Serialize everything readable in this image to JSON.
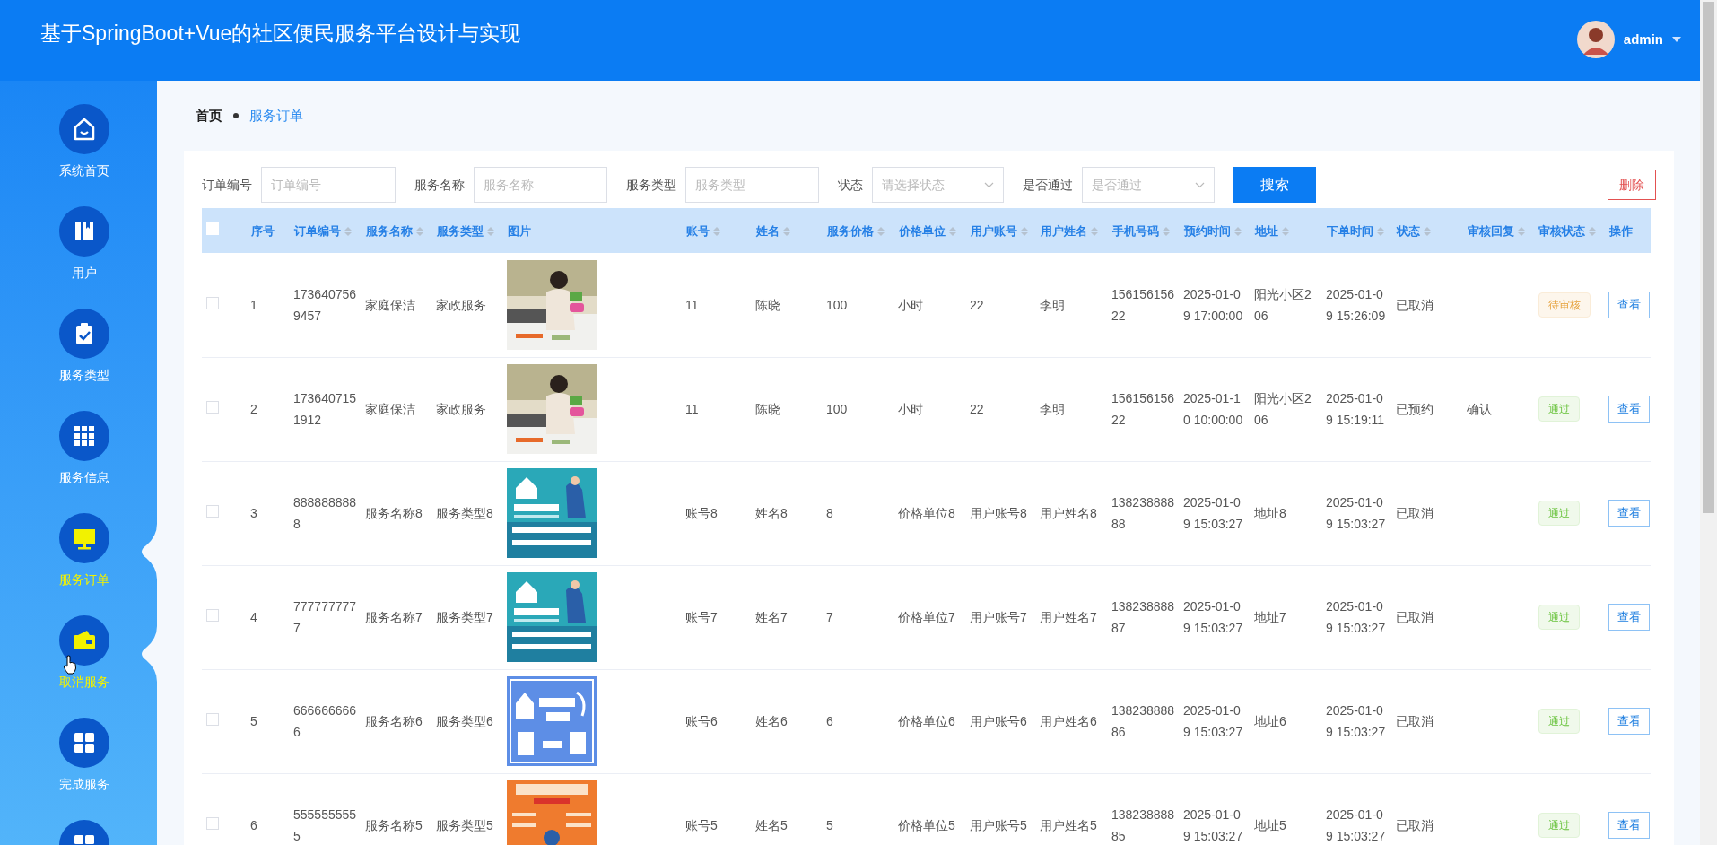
{
  "header": {
    "title": "基于SpringBoot+Vue的社区便民服务平台设计与实现",
    "user": "admin"
  },
  "sidebar": {
    "items": [
      {
        "label": "系统首页",
        "selected": false,
        "hovered": false
      },
      {
        "label": "用户",
        "selected": false,
        "hovered": false
      },
      {
        "label": "服务类型",
        "selected": false,
        "hovered": false
      },
      {
        "label": "服务信息",
        "selected": false,
        "hovered": false
      },
      {
        "label": "服务订单",
        "selected": true,
        "hovered": false
      },
      {
        "label": "取消服务",
        "selected": true,
        "hovered": true
      },
      {
        "label": "完成服务",
        "selected": false,
        "hovered": false
      },
      {
        "selected": false,
        "hovered": false
      }
    ]
  },
  "breadcrumb": [
    "首页",
    "服务订单"
  ],
  "filters": [
    {
      "label": "订单编号",
      "kind": "text",
      "placeholder": "订单编号"
    },
    {
      "label": "服务名称",
      "kind": "text",
      "placeholder": "服务名称"
    },
    {
      "label": "服务类型",
      "kind": "text",
      "placeholder": "服务类型"
    },
    {
      "label": "状态",
      "kind": "select",
      "placeholder": "请选择状态"
    },
    {
      "label": "是否通过",
      "kind": "select",
      "placeholder": "是否通过"
    }
  ],
  "search_button": "搜索",
  "delete_button": "删除",
  "table": {
    "header_checked": false,
    "columns": [
      {
        "label": "序号",
        "sortable": false
      },
      {
        "label": "订单编号",
        "sortable": true
      },
      {
        "label": "服务名称",
        "sortable": true
      },
      {
        "label": "服务类型",
        "sortable": true
      },
      {
        "label": "图片",
        "sortable": false
      },
      {
        "label": "账号",
        "sortable": true
      },
      {
        "label": "姓名",
        "sortable": true
      },
      {
        "label": "服务价格",
        "sortable": true
      },
      {
        "label": "价格单位",
        "sortable": true
      },
      {
        "label": "用户账号",
        "sortable": true
      },
      {
        "label": "用户姓名",
        "sortable": true
      },
      {
        "label": "手机号码",
        "sortable": true
      },
      {
        "label": "预约时间",
        "sortable": true
      },
      {
        "label": "地址",
        "sortable": true
      },
      {
        "label": "下单时间",
        "sortable": true
      },
      {
        "label": "状态",
        "sortable": true
      },
      {
        "label": "审核回复",
        "sortable": true
      },
      {
        "label": "审核状态",
        "sortable": true
      },
      {
        "label": "操作",
        "sortable": false
      }
    ],
    "rows": [
      {
        "checked": false,
        "cells": [
          "1",
          "1736407569457",
          "家庭保洁",
          "家政服务",
          {
            "kind": "picture"
          },
          "11",
          "陈晓",
          "100",
          "小时",
          "22",
          "李明",
          "15615615622",
          "2025-01-09 17:00:00",
          "阳光小区206",
          "2025-01-09 15:26:09",
          "已取消",
          ""
        ],
        "review_status": {
          "text": "待审核",
          "kind": "pending"
        },
        "action": "查看"
      },
      {
        "checked": false,
        "cells": [
          "2",
          "1736407151912",
          "家庭保洁",
          "家政服务",
          {
            "kind": "picture"
          },
          "11",
          "陈晓",
          "100",
          "小时",
          "22",
          "李明",
          "15615615622",
          "2025-01-10 10:00:00",
          "阳光小区206",
          "2025-01-09 15:19:11",
          "已预约",
          "确认"
        ],
        "review_status": {
          "text": "通过",
          "kind": "approved"
        },
        "action": "查看"
      },
      {
        "checked": false,
        "cells": [
          "3",
          "8888888888",
          "服务名称8",
          "服务类型8",
          {
            "kind": "picture"
          },
          "账号8",
          "姓名8",
          "8",
          "价格单位8",
          "用户账号8",
          "用户姓名8",
          "13823888888",
          "2025-01-09 15:03:27",
          "地址8",
          "2025-01-09 15:03:27",
          "已取消",
          ""
        ],
        "review_status": {
          "text": "通过",
          "kind": "approved"
        },
        "action": "查看"
      },
      {
        "checked": false,
        "cells": [
          "4",
          "7777777777",
          "服务名称7",
          "服务类型7",
          {
            "kind": "picture"
          },
          "账号7",
          "姓名7",
          "7",
          "价格单位7",
          "用户账号7",
          "用户姓名7",
          "13823888887",
          "2025-01-09 15:03:27",
          "地址7",
          "2025-01-09 15:03:27",
          "已取消",
          ""
        ],
        "review_status": {
          "text": "通过",
          "kind": "approved"
        },
        "action": "查看"
      },
      {
        "checked": false,
        "cells": [
          "5",
          "6666666666",
          "服务名称6",
          "服务类型6",
          {
            "kind": "picture"
          },
          "账号6",
          "姓名6",
          "6",
          "价格单位6",
          "用户账号6",
          "用户姓名6",
          "13823888886",
          "2025-01-09 15:03:27",
          "地址6",
          "2025-01-09 15:03:27",
          "已取消",
          ""
        ],
        "review_status": {
          "text": "通过",
          "kind": "approved"
        },
        "action": "查看"
      },
      {
        "checked": false,
        "cells": [
          "6",
          "5555555555",
          "服务名称5",
          "服务类型5",
          {
            "kind": "picture"
          },
          "账号5",
          "姓名5",
          "5",
          "价格单位5",
          "用户账号5",
          "用户姓名5",
          "13823888885",
          "2025-01-09 15:03:27",
          "地址5",
          "2025-01-09 15:03:27",
          "已取消",
          ""
        ],
        "review_status": {
          "text": "通过",
          "kind": "approved"
        },
        "action": "查看"
      }
    ]
  }
}
